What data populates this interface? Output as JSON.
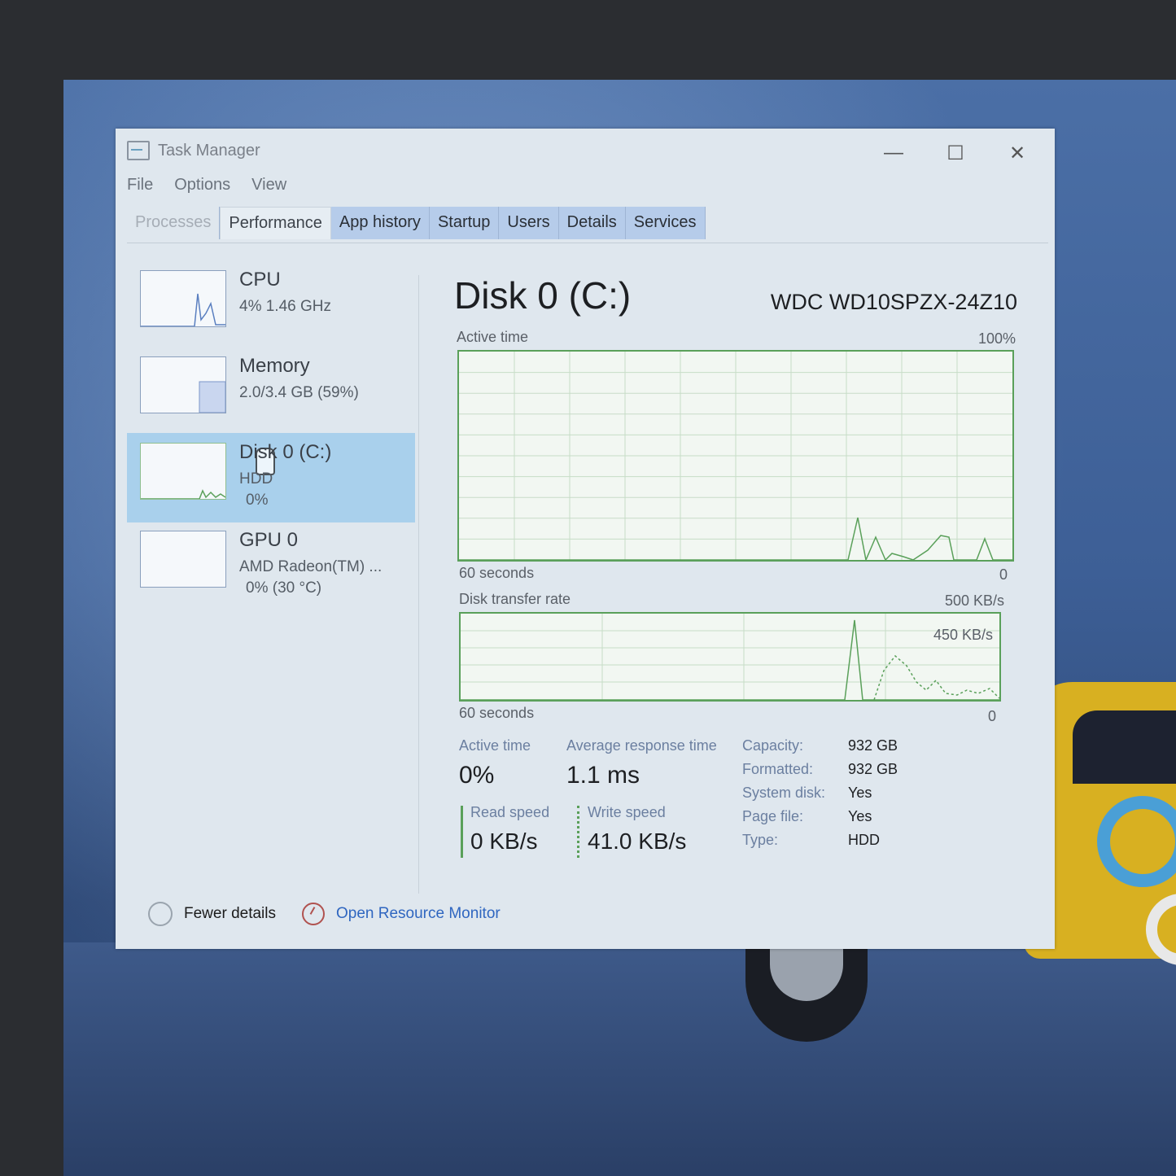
{
  "window": {
    "title": "Task Manager",
    "controls": {
      "minimize": "—",
      "maximize": "☐",
      "close": "✕"
    }
  },
  "menu": [
    "File",
    "Options",
    "View"
  ],
  "tabs": [
    {
      "label": "Processes",
      "state": "dim"
    },
    {
      "label": "Performance",
      "state": "active"
    },
    {
      "label": "App history",
      "state": "normal"
    },
    {
      "label": "Startup",
      "state": "normal"
    },
    {
      "label": "Users",
      "state": "normal"
    },
    {
      "label": "Details",
      "state": "normal"
    },
    {
      "label": "Services",
      "state": "normal"
    }
  ],
  "sidebar": {
    "items": [
      {
        "name": "CPU",
        "sub": "4%  1.46 GHz",
        "sub2": "",
        "selected": false
      },
      {
        "name": "Memory",
        "sub": "2.0/3.4 GB (59%)",
        "sub2": "",
        "selected": false
      },
      {
        "name": "Disk 0 (C:)",
        "sub": "HDD",
        "sub2": "0%",
        "selected": true
      },
      {
        "name": "GPU 0",
        "sub": "AMD Radeon(TM) ...",
        "sub2": "0% (30 °C)",
        "selected": false
      }
    ]
  },
  "main": {
    "title": "Disk 0 (C:)",
    "model": "WDC WD10SPZX-24Z10",
    "active_time_graph": {
      "label": "Active time",
      "max_label": "100%",
      "time_label": "60 seconds",
      "min_label": "0"
    },
    "transfer_graph": {
      "label": "Disk transfer rate",
      "max_label": "500 KB/s",
      "inner_label": "450 KB/s",
      "time_label": "60 seconds",
      "min_label": "0"
    },
    "stats": {
      "active_time_label": "Active time",
      "active_time_value": "0%",
      "avg_response_label": "Average response time",
      "avg_response_value": "1.1 ms",
      "read_speed_label": "Read speed",
      "read_speed_value": "0 KB/s",
      "write_speed_label": "Write speed",
      "write_speed_value": "41.0 KB/s"
    },
    "properties": [
      {
        "key": "Capacity:",
        "value": "932 GB"
      },
      {
        "key": "Formatted:",
        "value": "932 GB"
      },
      {
        "key": "System disk:",
        "value": "Yes"
      },
      {
        "key": "Page file:",
        "value": "Yes"
      },
      {
        "key": "Type:",
        "value": "HDD"
      }
    ]
  },
  "footer": {
    "fewer_details": "Fewer details",
    "open_resource_monitor": "Open Resource Monitor"
  },
  "colors": {
    "disk_accent": "#5aa05a",
    "selected_item": "#a9d0ec",
    "link": "#2f66c0"
  }
}
